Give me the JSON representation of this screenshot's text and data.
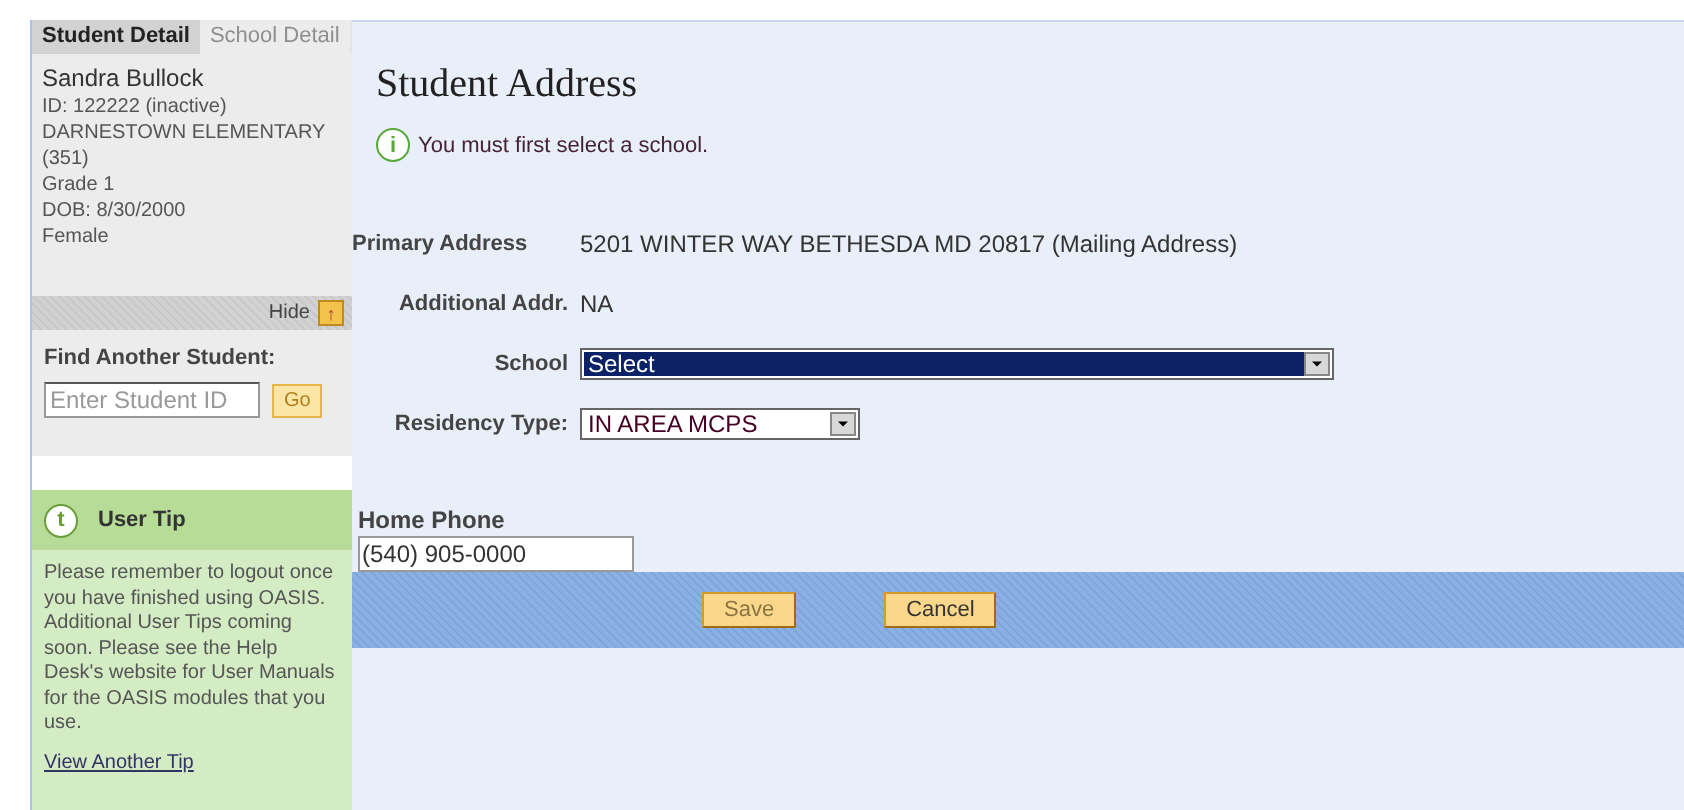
{
  "sidebar": {
    "tabs": [
      {
        "label": "Student Detail",
        "selected": true
      },
      {
        "label": "School Detail",
        "selected": false
      }
    ],
    "student": {
      "name": "Sandra Bullock",
      "lines": [
        "ID: 122222 (inactive)",
        "DARNESTOWN ELEMENTARY",
        "(351)",
        "Grade 1",
        "DOB: 8/30/2000",
        "Female"
      ]
    },
    "hide_button": {
      "label": "Hide",
      "icon": "↑"
    },
    "find": {
      "title": "Find Another Student:",
      "placeholder": "Enter Student ID",
      "button": "Go"
    },
    "tip": {
      "icon": "t",
      "title": "User Tip",
      "text": "Please remember to logout once you have finished using OASIS.  Additional User Tips coming soon. Please see the Help Desk's website for User Manuals for the OASIS modules that you use.",
      "link": "View Another Tip"
    }
  },
  "main": {
    "title": "Student Address",
    "message": {
      "icon": "i",
      "text": "You must first select a school."
    },
    "primary_address": {
      "label": "Primary Address",
      "value": "5201 WINTER WAY BETHESDA MD 20817 (Mailing Address)"
    },
    "additional_address": {
      "label": "Additional Addr.",
      "value": "NA"
    },
    "school": {
      "label": "School",
      "value": "Select",
      "focused": true
    },
    "residency": {
      "label": "Residency Type:",
      "value": "IN AREA MCPS",
      "focused": false
    },
    "home_phone": {
      "label": "Home Phone",
      "value": "(540) 905-0000"
    },
    "buttons": [
      {
        "label": "Save",
        "disabled": true
      },
      {
        "label": "Cancel",
        "disabled": false
      }
    ]
  }
}
